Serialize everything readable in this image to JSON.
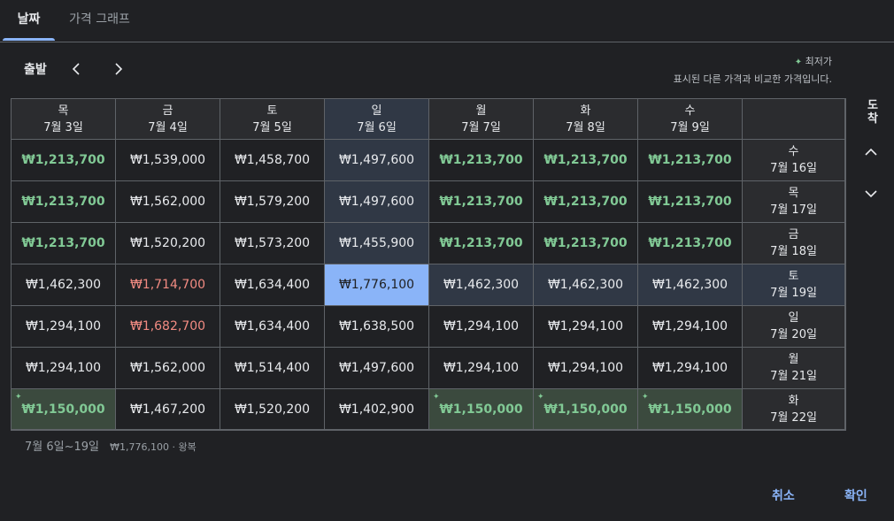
{
  "tabs": [
    "날짜",
    "가격 그래프"
  ],
  "departure": {
    "label": "출발"
  },
  "arrival": {
    "label": "도착"
  },
  "legend": {
    "title": "최저가",
    "note": "표시된 다른 가격과 비교한 가격입니다."
  },
  "columns": [
    {
      "day": "목",
      "date": "7월 3일"
    },
    {
      "day": "금",
      "date": "7월 4일"
    },
    {
      "day": "토",
      "date": "7월 5일"
    },
    {
      "day": "일",
      "date": "7월 6일"
    },
    {
      "day": "월",
      "date": "7월 7일"
    },
    {
      "day": "화",
      "date": "7월 8일"
    },
    {
      "day": "수",
      "date": "7월 9일"
    }
  ],
  "rows": [
    {
      "day": "수",
      "date": "7월 16일",
      "prices": [
        "₩1,213,700",
        "₩1,539,000",
        "₩1,458,700",
        "₩1,497,600",
        "₩1,213,700",
        "₩1,213,700",
        "₩1,213,700"
      ]
    },
    {
      "day": "목",
      "date": "7월 17일",
      "prices": [
        "₩1,213,700",
        "₩1,562,000",
        "₩1,579,200",
        "₩1,497,600",
        "₩1,213,700",
        "₩1,213,700",
        "₩1,213,700"
      ]
    },
    {
      "day": "금",
      "date": "7월 18일",
      "prices": [
        "₩1,213,700",
        "₩1,520,200",
        "₩1,573,200",
        "₩1,455,900",
        "₩1,213,700",
        "₩1,213,700",
        "₩1,213,700"
      ]
    },
    {
      "day": "토",
      "date": "7월 19일",
      "prices": [
        "₩1,462,300",
        "₩1,714,700",
        "₩1,634,400",
        "₩1,776,100",
        "₩1,462,300",
        "₩1,462,300",
        "₩1,462,300"
      ]
    },
    {
      "day": "일",
      "date": "7월 20일",
      "prices": [
        "₩1,294,100",
        "₩1,682,700",
        "₩1,634,400",
        "₩1,638,500",
        "₩1,294,100",
        "₩1,294,100",
        "₩1,294,100"
      ]
    },
    {
      "day": "월",
      "date": "7월 21일",
      "prices": [
        "₩1,294,100",
        "₩1,562,000",
        "₩1,514,400",
        "₩1,497,600",
        "₩1,294,100",
        "₩1,294,100",
        "₩1,294,100"
      ]
    },
    {
      "day": "화",
      "date": "7월 22일",
      "prices": [
        "₩1,150,000",
        "₩1,467,200",
        "₩1,520,200",
        "₩1,402,900",
        "₩1,150,000",
        "₩1,150,000",
        "₩1,150,000"
      ]
    }
  ],
  "low_cells": [
    "0-0",
    "0-4",
    "0-5",
    "0-6",
    "1-0",
    "1-4",
    "1-5",
    "1-6",
    "2-0",
    "2-4",
    "2-5",
    "2-6",
    "6-0",
    "6-4",
    "6-5",
    "6-6"
  ],
  "high_cells": [
    "3-1",
    "4-1"
  ],
  "best_cells": [
    "6-0",
    "6-4",
    "6-5",
    "6-6"
  ],
  "selected": {
    "row": 3,
    "col": 3
  },
  "summary": {
    "dates": "7월 6일~19일",
    "price": "₩1,776,100 · 왕복"
  },
  "buttons": {
    "cancel": "취소",
    "ok": "확인"
  },
  "colors": {
    "accent": "#8ab4f8",
    "low": "#81c995",
    "high": "#f28b82",
    "background": "#202124"
  }
}
